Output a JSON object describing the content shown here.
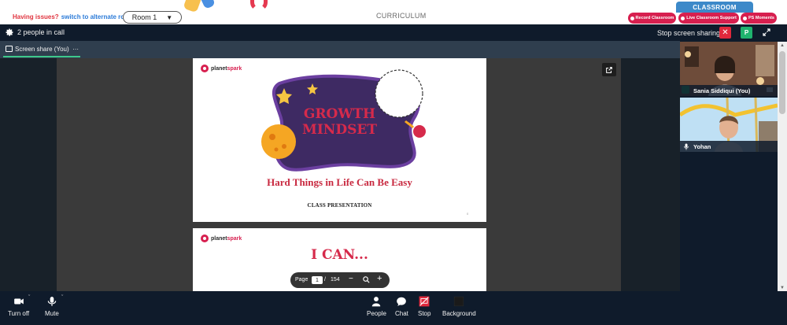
{
  "top": {
    "issue_text": "Having issues?",
    "alt_room_link": "switch to alternate room",
    "room_select": "Room 1",
    "curriculum": "CURRICULUM",
    "classroom_tab": "CLASSROOM",
    "pills": [
      "Record Classroom",
      "Live Classroom Support",
      "PS Moments"
    ]
  },
  "call": {
    "people_in_call": "2 people in call",
    "stop_sharing": "Stop screen sharing",
    "close_glyph": "✕",
    "avatar_letter": "P"
  },
  "share": {
    "label": "Screen share (You)",
    "more": "···"
  },
  "slides": {
    "brand_a": "planet",
    "brand_b": "spark",
    "title_line1": "GROWTH",
    "title_line2": "MINDSET",
    "subtitle": "Hard Things in Life Can Be Easy",
    "presentation": "CLASS PRESENTATION",
    "slide_no": "0",
    "slide2_title": "I CAN..."
  },
  "pager": {
    "label": "Page",
    "current": "1",
    "separator": "/",
    "total": "154",
    "minus": "−",
    "plus": "+"
  },
  "participants": [
    {
      "name": "Sania Siddiqui (You)"
    },
    {
      "name": "Yohan"
    }
  ],
  "toolbar": {
    "video": "Turn off",
    "mute": "Mute",
    "people": "People",
    "chat": "Chat",
    "stop": "Stop",
    "background": "Background",
    "caret": "ˇ"
  },
  "colors": {
    "accent_red": "#d71f4f",
    "call_bg": "#0f1b2b",
    "share_green": "#3ec88b",
    "classroom_blue": "#3c89c9"
  }
}
